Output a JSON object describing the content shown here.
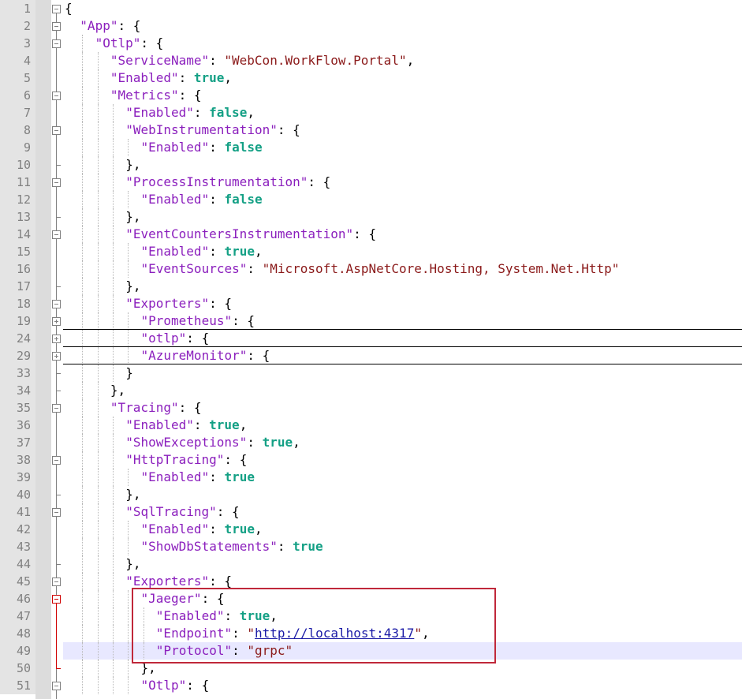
{
  "editor": {
    "lines": [
      {
        "n": "1",
        "indent": 0,
        "fold": "open",
        "tokens": [
          {
            "t": "p",
            "v": "{"
          }
        ]
      },
      {
        "n": "2",
        "indent": 1,
        "fold": "open",
        "tokens": [
          {
            "t": "k",
            "v": "\"App\""
          },
          {
            "t": "p",
            "v": ": {"
          }
        ]
      },
      {
        "n": "3",
        "indent": 2,
        "fold": "open",
        "tokens": [
          {
            "t": "k",
            "v": "\"Otlp\""
          },
          {
            "t": "p",
            "v": ": {"
          }
        ]
      },
      {
        "n": "4",
        "indent": 3,
        "fold": "",
        "tokens": [
          {
            "t": "k",
            "v": "\"ServiceName\""
          },
          {
            "t": "p",
            "v": ": "
          },
          {
            "t": "s",
            "v": "\"WebCon.WorkFlow.Portal\""
          },
          {
            "t": "p",
            "v": ","
          }
        ]
      },
      {
        "n": "5",
        "indent": 3,
        "fold": "",
        "tokens": [
          {
            "t": "k",
            "v": "\"Enabled\""
          },
          {
            "t": "p",
            "v": ": "
          },
          {
            "t": "b",
            "v": "true"
          },
          {
            "t": "p",
            "v": ","
          }
        ]
      },
      {
        "n": "6",
        "indent": 3,
        "fold": "open",
        "tokens": [
          {
            "t": "k",
            "v": "\"Metrics\""
          },
          {
            "t": "p",
            "v": ": {"
          }
        ]
      },
      {
        "n": "7",
        "indent": 4,
        "fold": "",
        "tokens": [
          {
            "t": "k",
            "v": "\"Enabled\""
          },
          {
            "t": "p",
            "v": ": "
          },
          {
            "t": "b",
            "v": "false"
          },
          {
            "t": "p",
            "v": ","
          }
        ]
      },
      {
        "n": "8",
        "indent": 4,
        "fold": "open",
        "tokens": [
          {
            "t": "k",
            "v": "\"WebInstrumentation\""
          },
          {
            "t": "p",
            "v": ": {"
          }
        ]
      },
      {
        "n": "9",
        "indent": 5,
        "fold": "",
        "tokens": [
          {
            "t": "k",
            "v": "\"Enabled\""
          },
          {
            "t": "p",
            "v": ": "
          },
          {
            "t": "b",
            "v": "false"
          }
        ]
      },
      {
        "n": "10",
        "indent": 4,
        "fold": "end",
        "tokens": [
          {
            "t": "p",
            "v": "},"
          }
        ]
      },
      {
        "n": "11",
        "indent": 4,
        "fold": "open",
        "tokens": [
          {
            "t": "k",
            "v": "\"ProcessInstrumentation\""
          },
          {
            "t": "p",
            "v": ": {"
          }
        ]
      },
      {
        "n": "12",
        "indent": 5,
        "fold": "",
        "tokens": [
          {
            "t": "k",
            "v": "\"Enabled\""
          },
          {
            "t": "p",
            "v": ": "
          },
          {
            "t": "b",
            "v": "false"
          }
        ]
      },
      {
        "n": "13",
        "indent": 4,
        "fold": "end",
        "tokens": [
          {
            "t": "p",
            "v": "},"
          }
        ]
      },
      {
        "n": "14",
        "indent": 4,
        "fold": "open",
        "tokens": [
          {
            "t": "k",
            "v": "\"EventCountersInstrumentation\""
          },
          {
            "t": "p",
            "v": ": {"
          }
        ]
      },
      {
        "n": "15",
        "indent": 5,
        "fold": "",
        "tokens": [
          {
            "t": "k",
            "v": "\"Enabled\""
          },
          {
            "t": "p",
            "v": ": "
          },
          {
            "t": "b",
            "v": "true"
          },
          {
            "t": "p",
            "v": ","
          }
        ]
      },
      {
        "n": "16",
        "indent": 5,
        "fold": "",
        "tokens": [
          {
            "t": "k",
            "v": "\"EventSources\""
          },
          {
            "t": "p",
            "v": ": "
          },
          {
            "t": "s",
            "v": "\"Microsoft.AspNetCore.Hosting, System.Net.Http\""
          }
        ]
      },
      {
        "n": "17",
        "indent": 4,
        "fold": "end",
        "tokens": [
          {
            "t": "p",
            "v": "},"
          }
        ]
      },
      {
        "n": "18",
        "indent": 4,
        "fold": "open",
        "tokens": [
          {
            "t": "k",
            "v": "\"Exporters\""
          },
          {
            "t": "p",
            "v": ": {"
          }
        ]
      },
      {
        "n": "19",
        "indent": 5,
        "fold": "closed",
        "tokens": [
          {
            "t": "k",
            "v": "\"Prometheus\""
          },
          {
            "t": "p",
            "v": ": {"
          }
        ]
      },
      {
        "n": "24",
        "indent": 5,
        "fold": "closed",
        "tokens": [
          {
            "t": "k",
            "v": "\"otlp\""
          },
          {
            "t": "p",
            "v": ": {"
          }
        ]
      },
      {
        "n": "29",
        "indent": 5,
        "fold": "closed",
        "tokens": [
          {
            "t": "k",
            "v": "\"AzureMonitor\""
          },
          {
            "t": "p",
            "v": ": {"
          }
        ]
      },
      {
        "n": "33",
        "indent": 4,
        "fold": "end",
        "tokens": [
          {
            "t": "p",
            "v": "}"
          }
        ]
      },
      {
        "n": "34",
        "indent": 3,
        "fold": "end",
        "tokens": [
          {
            "t": "p",
            "v": "},"
          }
        ]
      },
      {
        "n": "35",
        "indent": 3,
        "fold": "open",
        "tokens": [
          {
            "t": "k",
            "v": "\"Tracing\""
          },
          {
            "t": "p",
            "v": ": {"
          }
        ]
      },
      {
        "n": "36",
        "indent": 4,
        "fold": "",
        "tokens": [
          {
            "t": "k",
            "v": "\"Enabled\""
          },
          {
            "t": "p",
            "v": ": "
          },
          {
            "t": "b",
            "v": "true"
          },
          {
            "t": "p",
            "v": ","
          }
        ]
      },
      {
        "n": "37",
        "indent": 4,
        "fold": "",
        "tokens": [
          {
            "t": "k",
            "v": "\"ShowExceptions\""
          },
          {
            "t": "p",
            "v": ": "
          },
          {
            "t": "b",
            "v": "true"
          },
          {
            "t": "p",
            "v": ","
          }
        ]
      },
      {
        "n": "38",
        "indent": 4,
        "fold": "open",
        "tokens": [
          {
            "t": "k",
            "v": "\"HttpTracing\""
          },
          {
            "t": "p",
            "v": ": {"
          }
        ]
      },
      {
        "n": "39",
        "indent": 5,
        "fold": "",
        "tokens": [
          {
            "t": "k",
            "v": "\"Enabled\""
          },
          {
            "t": "p",
            "v": ": "
          },
          {
            "t": "b",
            "v": "true"
          }
        ]
      },
      {
        "n": "40",
        "indent": 4,
        "fold": "end",
        "tokens": [
          {
            "t": "p",
            "v": "},"
          }
        ]
      },
      {
        "n": "41",
        "indent": 4,
        "fold": "open",
        "tokens": [
          {
            "t": "k",
            "v": "\"SqlTracing\""
          },
          {
            "t": "p",
            "v": ": {"
          }
        ]
      },
      {
        "n": "42",
        "indent": 5,
        "fold": "",
        "tokens": [
          {
            "t": "k",
            "v": "\"Enabled\""
          },
          {
            "t": "p",
            "v": ": "
          },
          {
            "t": "b",
            "v": "true"
          },
          {
            "t": "p",
            "v": ","
          }
        ]
      },
      {
        "n": "43",
        "indent": 5,
        "fold": "",
        "tokens": [
          {
            "t": "k",
            "v": "\"ShowDbStatements\""
          },
          {
            "t": "p",
            "v": ": "
          },
          {
            "t": "b",
            "v": "true"
          }
        ]
      },
      {
        "n": "44",
        "indent": 4,
        "fold": "end",
        "tokens": [
          {
            "t": "p",
            "v": "},"
          }
        ]
      },
      {
        "n": "45",
        "indent": 4,
        "fold": "open",
        "tokens": [
          {
            "t": "k",
            "v": "\"Exporters\""
          },
          {
            "t": "p",
            "v": ": {"
          }
        ]
      },
      {
        "n": "46",
        "indent": 5,
        "fold": "open-red",
        "tokens": [
          {
            "t": "k",
            "v": "\"Jaeger\""
          },
          {
            "t": "p",
            "v": ": {"
          }
        ]
      },
      {
        "n": "47",
        "indent": 6,
        "fold": "",
        "tokens": [
          {
            "t": "k",
            "v": "\"Enabled\""
          },
          {
            "t": "p",
            "v": ": "
          },
          {
            "t": "b",
            "v": "true"
          },
          {
            "t": "p",
            "v": ","
          }
        ]
      },
      {
        "n": "48",
        "indent": 6,
        "fold": "",
        "tokens": [
          {
            "t": "k",
            "v": "\"Endpoint\""
          },
          {
            "t": "p",
            "v": ": "
          },
          {
            "t": "s",
            "v": "\""
          },
          {
            "t": "u",
            "v": "http://localhost:4317"
          },
          {
            "t": "s",
            "v": "\""
          },
          {
            "t": "p",
            "v": ","
          }
        ]
      },
      {
        "n": "49",
        "indent": 6,
        "fold": "",
        "current": true,
        "tokens": [
          {
            "t": "k",
            "v": "\"Protocol\""
          },
          {
            "t": "p",
            "v": ": "
          },
          {
            "t": "s",
            "v": "\"grpc\""
          }
        ]
      },
      {
        "n": "50",
        "indent": 5,
        "fold": "end-red",
        "tokens": [
          {
            "t": "p",
            "v": "},"
          }
        ]
      },
      {
        "n": "51",
        "indent": 5,
        "fold": "open",
        "tokens": [
          {
            "t": "k",
            "v": "\"Otlp\""
          },
          {
            "t": "p",
            "v": ": {"
          }
        ]
      }
    ]
  },
  "colors": {
    "key": "#8b1fbd",
    "string": "#8b1a1a",
    "boolean": "#14a085",
    "link": "#1a1aa6",
    "highlight_border": "#c0283a",
    "current_line": "#e8e8ff"
  }
}
